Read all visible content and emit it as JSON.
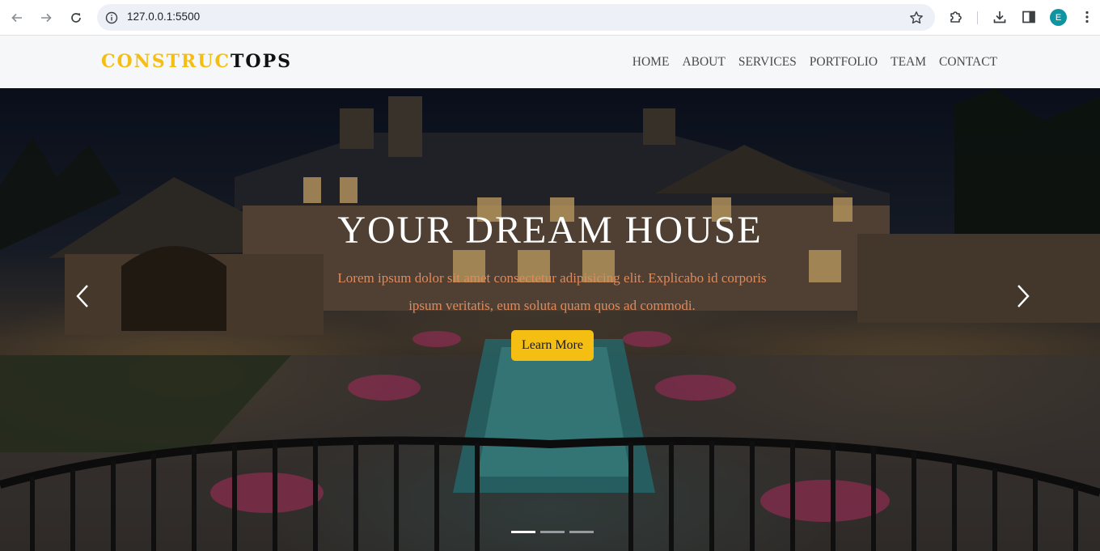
{
  "browser": {
    "url": "127.0.0.1:5500",
    "profile_initial": "E",
    "icons": [
      "back-icon",
      "forward-icon",
      "reload-icon",
      "info-icon",
      "star-icon",
      "extensions-icon",
      "download-icon",
      "sidebar-icon",
      "kebab-menu-icon"
    ]
  },
  "navbar": {
    "brand_part1": "CONSTRUC",
    "brand_part2": "TOPS",
    "menu": [
      "HOME",
      "ABOUT",
      "SERVICES",
      "PORTFOLIO",
      "TEAM",
      "CONTACT"
    ]
  },
  "hero": {
    "title": "YOUR DREAM HOUSE",
    "text": "Lorem ipsum dolor sit amet consectetur adipisicing elit. Explicabo id corporis ipsum veritatis, eum soluta quam quos ad commodi.",
    "button_label": "Learn More",
    "slides": 3,
    "active_slide": 1
  },
  "colors": {
    "accent": "#f5be12",
    "text_orange": "#e0895a",
    "nav_bg": "#f6f7f9"
  }
}
